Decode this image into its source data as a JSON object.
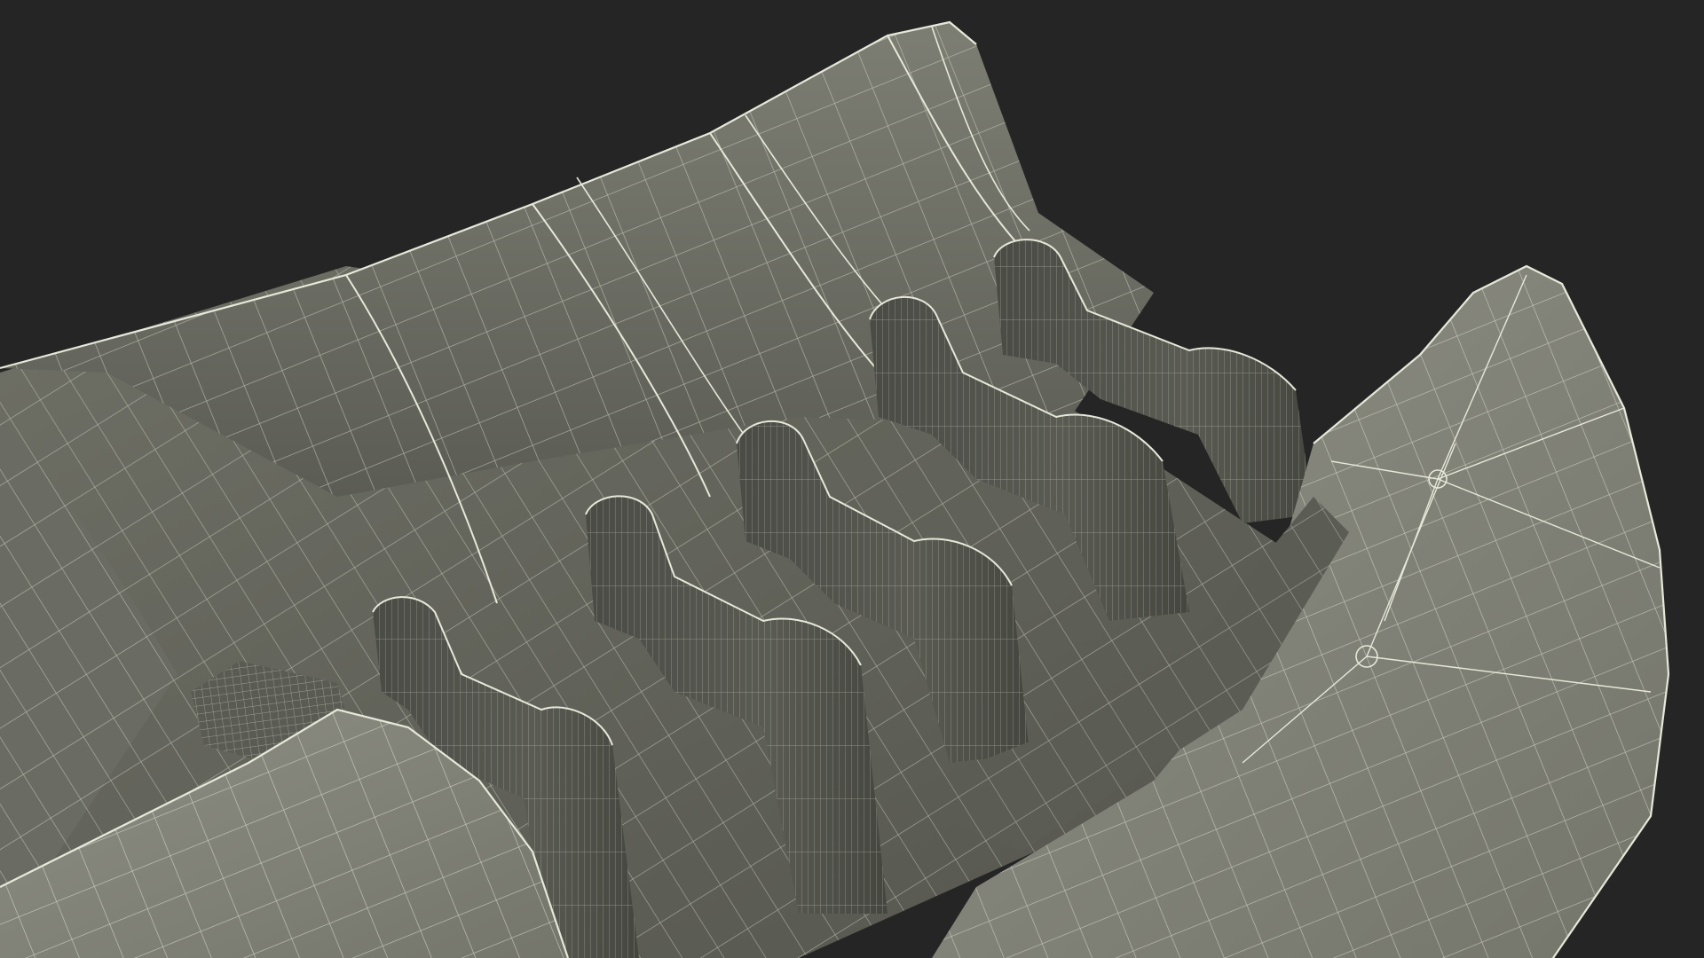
{
  "scene": {
    "subject": "wireframe-3d-model",
    "colors": {
      "background": "#252525",
      "surface_light": "#8a8b80",
      "surface_mid": "#6c6d63",
      "surface_dark": "#4e4f48",
      "surface_shadow": "#3b3c36",
      "wire": "#e6e8da"
    }
  }
}
